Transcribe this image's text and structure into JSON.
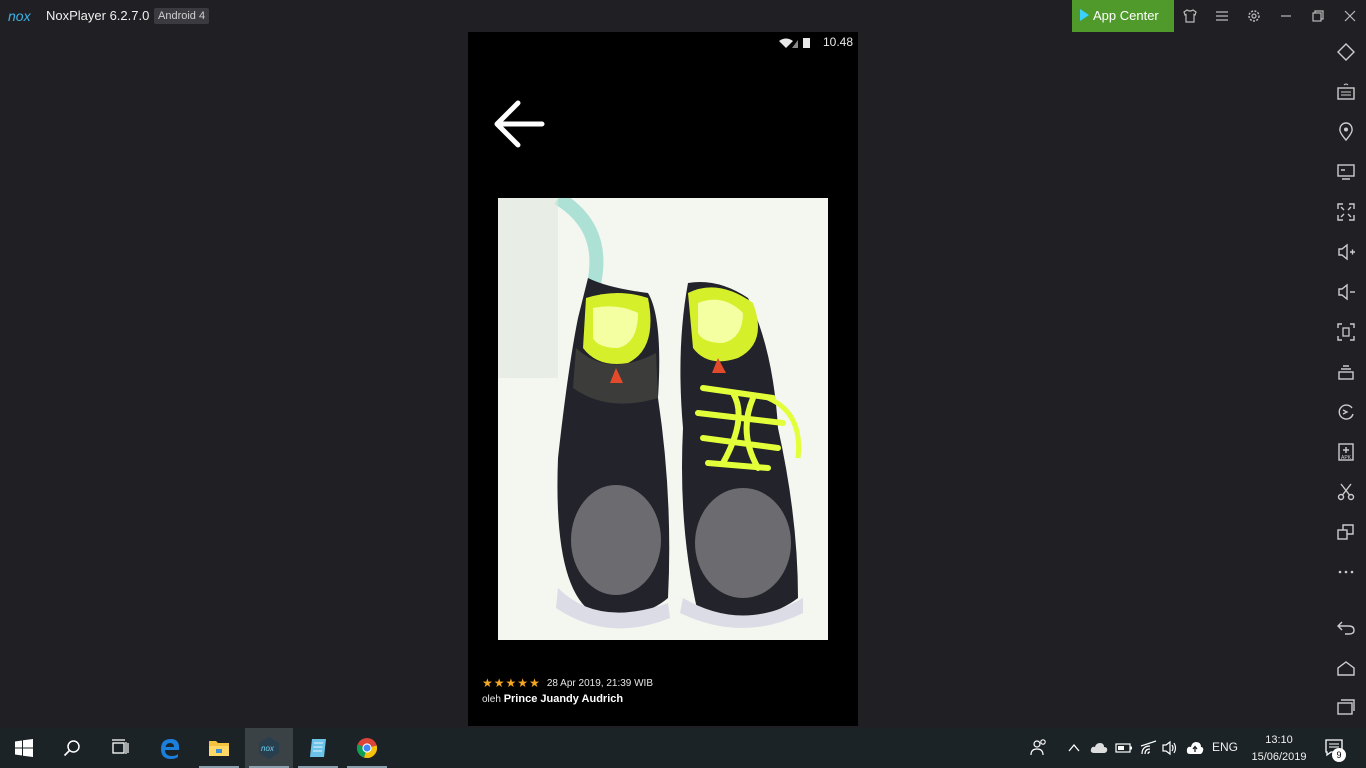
{
  "window": {
    "app_title": "NoxPlayer 6.2.7.0",
    "android_badge": "Android 4",
    "app_center_label": "App Center",
    "toolbar_icons": [
      "skin-icon",
      "menu-icon",
      "settings-icon",
      "minimize-icon",
      "restore-icon",
      "close-icon"
    ]
  },
  "phone": {
    "status_time": "10.48",
    "review": {
      "stars": 5,
      "date": "28 Apr 2019, 21:39 WIB",
      "by_prefix": "oleh",
      "author": "Prince Juandy Audrich"
    }
  },
  "sidebar_icons": [
    "rotate-icon",
    "keyboard-icon",
    "location-icon",
    "screen-icon",
    "fullscreen-icon",
    "volume-up-icon",
    "volume-down-icon",
    "screenshot-icon",
    "multi-instance-icon",
    "sync-icon",
    "apk-install-icon",
    "cut-icon",
    "multi-window-icon",
    "more-icon",
    "back-icon",
    "home-icon",
    "recents-icon"
  ],
  "taskbar": {
    "apps": [
      "start-icon",
      "search-icon",
      "task-view-icon",
      "edge-icon",
      "file-explorer-icon",
      "nox-icon",
      "notes-icon",
      "chrome-icon"
    ],
    "language": "ENG",
    "time": "13:10",
    "date": "15/06/2019",
    "notification_count": "9"
  }
}
